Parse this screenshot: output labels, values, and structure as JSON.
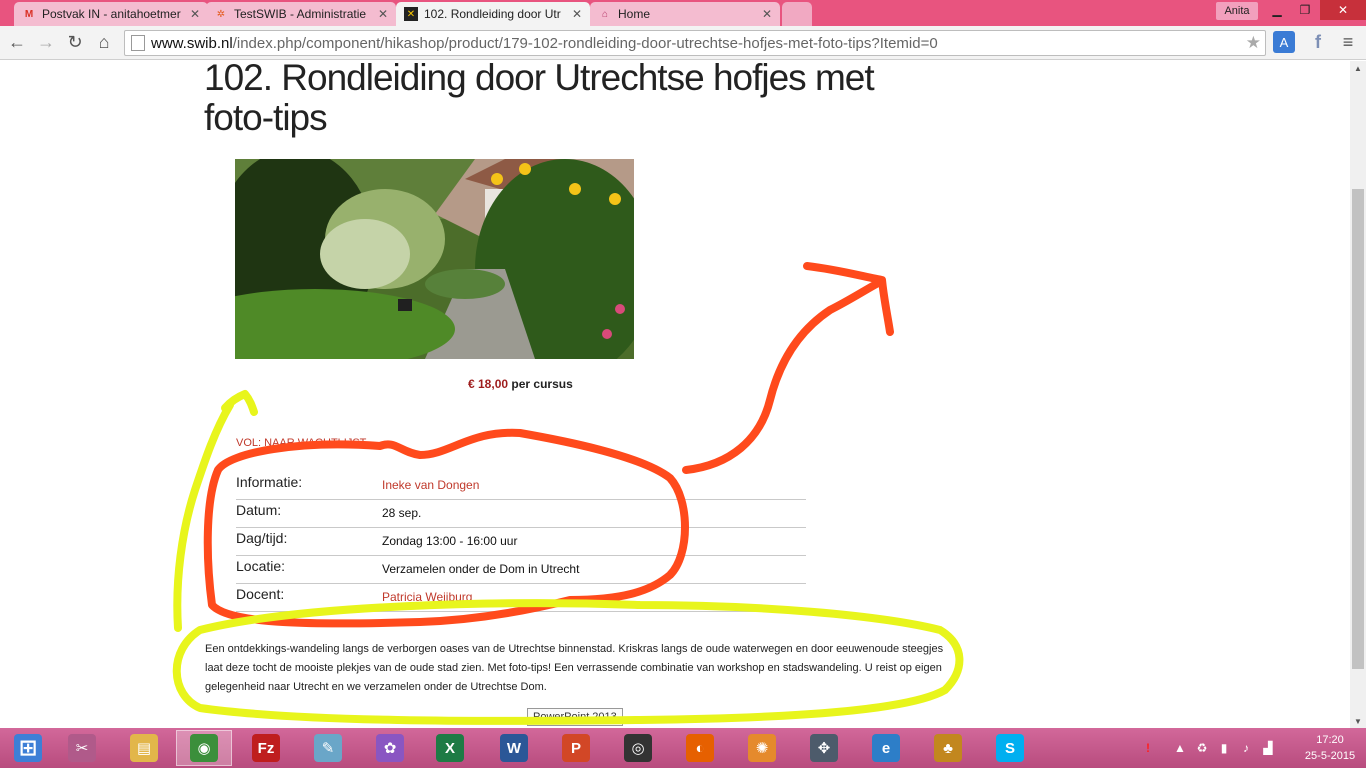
{
  "browser": {
    "tabs": [
      {
        "label": "Postvak IN - anitahoetmer",
        "icon": "gmail-icon"
      },
      {
        "label": "TestSWIB - Administratie",
        "icon": "joomla-icon"
      },
      {
        "label": "102. Rondleiding door Utr",
        "icon": "site-favicon"
      },
      {
        "label": "Home",
        "icon": "home-page-icon"
      }
    ],
    "close_glyph": "✕",
    "profile_name": "Anita",
    "url_host": "www.swib.nl",
    "url_path": "/index.php/component/hikashop/product/179-102-rondleiding-door-utrechtse-hofjes-met-foto-tips?Itemid=0"
  },
  "page": {
    "title": "102. Rondleiding door Utrechtse hofjes met foto-tips",
    "price_amount": "€ 18,00",
    "price_unit": "per cursus",
    "status_link": "VOL: NAAR WACHTLIJST",
    "info": [
      {
        "label": "Informatie:",
        "value": "Ineke van Dongen",
        "link": true
      },
      {
        "label": "Datum:",
        "value": "28 sep.",
        "link": false
      },
      {
        "label": "Dag/tijd:",
        "value": "Zondag 13:00 - 16:00 uur",
        "link": false
      },
      {
        "label": "Locatie:",
        "value": "Verzamelen onder de Dom in Utrecht",
        "link": false
      },
      {
        "label": "Docent:",
        "value": "Patricia Weijburg",
        "link": true
      }
    ],
    "description": "Een ontdekkings-wandeling langs de verborgen oases van de Utrechtse binnenstad. Kriskras langs de oude waterwegen en door eeuwenoude steegjes laat deze tocht de mooiste plekjes van de oude stad zien. Met foto-tips! Een verrassende combinatie van workshop en stadswandeling. U reist op eigen gelegenheid naar Utrecht en we verzamelen onder de Utrechtse Dom."
  },
  "tooltip": "PowerPoint 2013",
  "annotation_colors": {
    "orange": "#ff4a1c",
    "yellow": "#e8f51c"
  },
  "taskbar": {
    "apps": [
      {
        "name": "start",
        "glyph": "⊞",
        "color": "#3d7fd6"
      },
      {
        "name": "snipping",
        "glyph": "✂",
        "color": "#b05a8a"
      },
      {
        "name": "explorer",
        "glyph": "▤",
        "color": "#e2b64a"
      },
      {
        "name": "chrome",
        "glyph": "◉",
        "color": "#3b8f3b"
      },
      {
        "name": "filezilla",
        "glyph": "Fz",
        "color": "#bf1e1e"
      },
      {
        "name": "notepad",
        "glyph": "✎",
        "color": "#6aa6c8"
      },
      {
        "name": "picasa",
        "glyph": "✿",
        "color": "#8a56c2"
      },
      {
        "name": "excel",
        "glyph": "X",
        "color": "#1e7b45"
      },
      {
        "name": "word",
        "glyph": "W",
        "color": "#2b5797"
      },
      {
        "name": "powerpoint",
        "glyph": "P",
        "color": "#d24726"
      },
      {
        "name": "camera",
        "glyph": "◎",
        "color": "#333333"
      },
      {
        "name": "firefox",
        "glyph": "◐",
        "color": "#e66000"
      },
      {
        "name": "paint",
        "glyph": "✺",
        "color": "#e58a2c"
      },
      {
        "name": "tool",
        "glyph": "✥",
        "color": "#4d5b6b"
      },
      {
        "name": "ie",
        "glyph": "e",
        "color": "#2d7ec8"
      },
      {
        "name": "game",
        "glyph": "♣",
        "color": "#c2871e"
      },
      {
        "name": "skype",
        "glyph": "S",
        "color": "#00aff0"
      }
    ],
    "time": "17:20",
    "date": "25-5-2015"
  }
}
